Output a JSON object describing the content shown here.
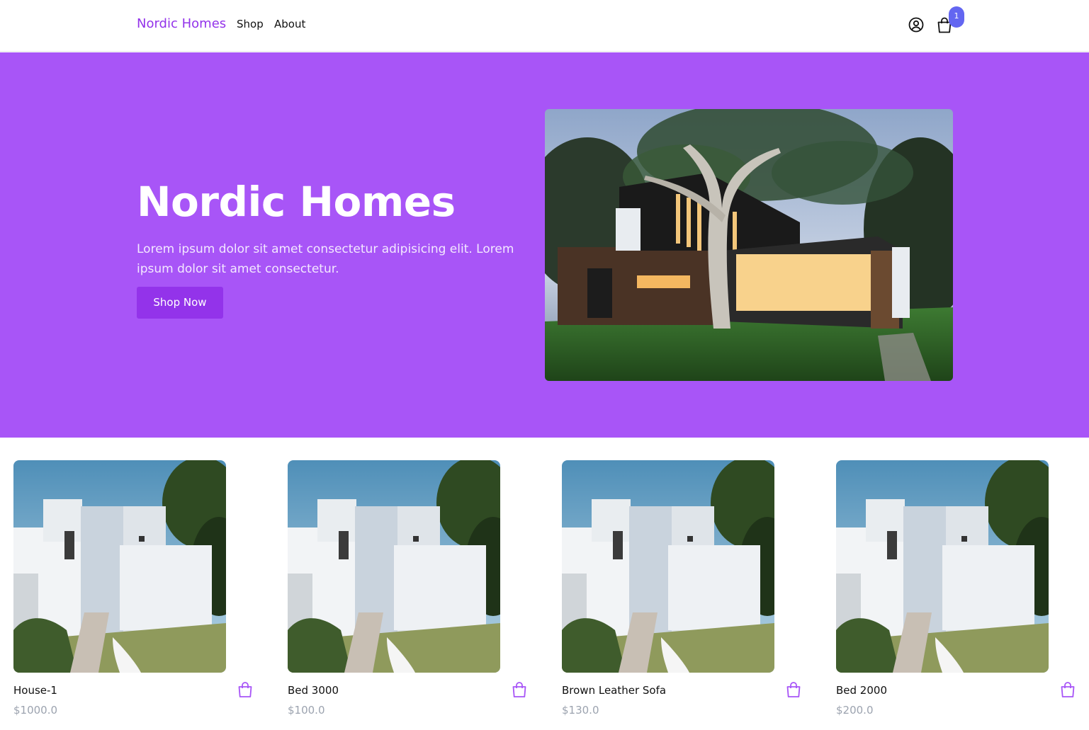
{
  "nav": {
    "brand": "Nordic Homes",
    "links": [
      "Shop",
      "About"
    ],
    "cart_count": "1",
    "icons": {
      "user": "user-circle-icon",
      "cart": "shopping-bag-icon"
    }
  },
  "hero": {
    "title": "Nordic Homes",
    "description": "Lorem ipsum dolor sit amet consectetur adipisicing elit. Lorem ipsum dolor sit amet consectetur.",
    "cta_label": "Shop Now",
    "background_color": "#a855f7",
    "cta_color": "#9333ea"
  },
  "products": [
    {
      "name": "House-1",
      "price": "$1000.0"
    },
    {
      "name": "Bed 3000",
      "price": "$100.0"
    },
    {
      "name": "Brown Leather Sofa",
      "price": "$130.0"
    },
    {
      "name": "Bed 2000",
      "price": "$200.0"
    }
  ],
  "colors": {
    "accent": "#9333ea",
    "badge": "#6366f1",
    "price_text": "#9ca3af"
  }
}
